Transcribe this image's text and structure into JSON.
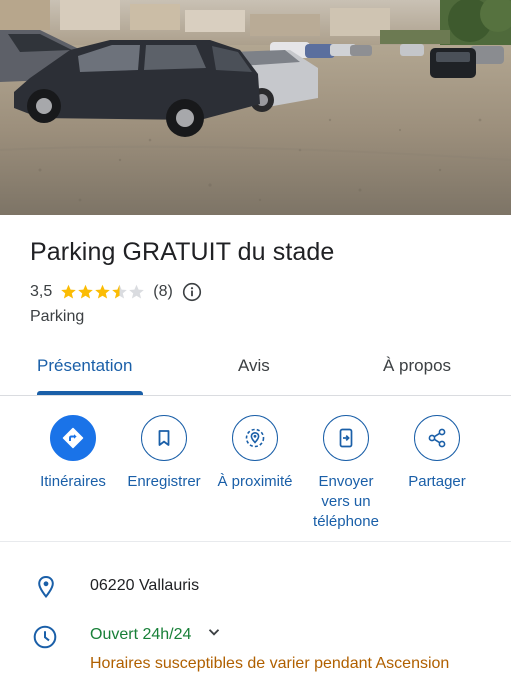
{
  "place": {
    "name": "Parking GRATUIT du stade",
    "rating": "3,5",
    "rating_value": 3.5,
    "rating_max": 5,
    "review_count": "(8)",
    "category": "Parking"
  },
  "tabs": [
    {
      "label": "Présentation",
      "active": true
    },
    {
      "label": "Avis",
      "active": false
    },
    {
      "label": "À propos",
      "active": false
    }
  ],
  "actions": [
    {
      "label": "Itinéraires",
      "icon": "directions-icon"
    },
    {
      "label": "Enregistrer",
      "icon": "bookmark-icon"
    },
    {
      "label": "À proximité",
      "icon": "nearby-icon"
    },
    {
      "label": "Envoyer vers un téléphone",
      "lines": [
        "Envoyer",
        "vers un",
        "téléphone"
      ],
      "icon": "send-to-phone-icon"
    },
    {
      "label": "Partager",
      "icon": "share-icon"
    }
  ],
  "details": {
    "address": "06220 Vallauris",
    "hours_status": "Ouvert 24h/24",
    "hours_notice": "Horaires susceptibles de varier pendant Ascension"
  },
  "colors": {
    "accent": "#1a5fa8",
    "primary_button": "#1a73e8",
    "star": "#fbbc04",
    "open_status": "#188038",
    "notice": "#b06000"
  }
}
